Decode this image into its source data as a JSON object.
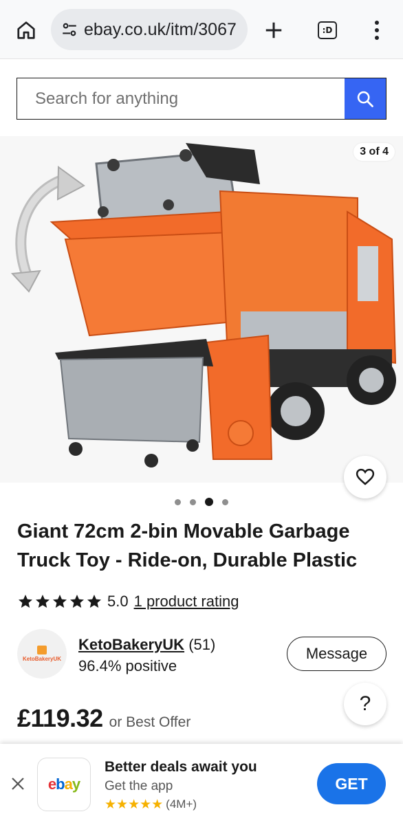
{
  "browser": {
    "url": "ebay.co.uk/itm/3067"
  },
  "search": {
    "placeholder": "Search for anything"
  },
  "gallery": {
    "counter": "3 of 4",
    "dot_count": 4,
    "active_dot": 3
  },
  "product": {
    "title": "Giant 72cm 2-bin Movable Garbage Truck Toy - Ride-on, Durable Plastic",
    "rating_value": "5.0",
    "rating_link": "1 product rating",
    "stars": 5
  },
  "seller": {
    "logo_text": "KetoBakeryUK",
    "name": "KetoBakeryUK",
    "feedback_count": "(51)",
    "positive": "96.4% positive",
    "message_label": "Message"
  },
  "help": {
    "label": "?"
  },
  "price": {
    "amount": "£119.32",
    "sub": "or Best Offer"
  },
  "app_banner": {
    "logo": "ebay",
    "title": "Better deals await you",
    "subtitle": "Get the app",
    "stars": "★★★★★",
    "rating_count": "(4M+)",
    "get_label": "GET"
  },
  "colors": {
    "brand_blue": "#3665f3",
    "get_blue": "#1a73e8",
    "star_gold": "#f6b100",
    "truck_orange": "#f26b2a"
  },
  "icons": [
    "home-icon",
    "tune-icon",
    "plus-icon",
    "tabs-icon",
    "more-vert-icon",
    "search-icon",
    "heart-icon",
    "star-icon",
    "close-icon"
  ]
}
